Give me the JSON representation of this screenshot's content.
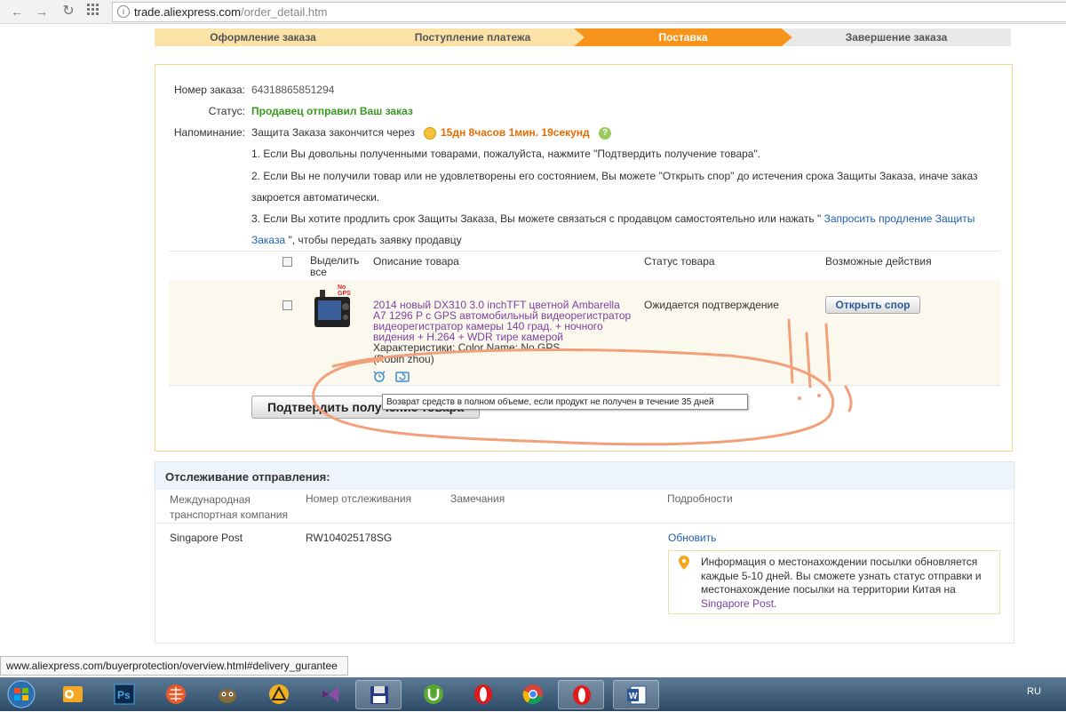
{
  "browser": {
    "url_domain": "trade.aliexpress.com",
    "url_path": "/order_detail.htm"
  },
  "steps": [
    {
      "label": "Оформление заказа",
      "state": "done"
    },
    {
      "label": "Поступление платежа",
      "state": "done"
    },
    {
      "label": "Поставка",
      "state": "current"
    },
    {
      "label": "Завершение заказа",
      "state": "pending"
    }
  ],
  "order": {
    "number_label": "Номер заказа:",
    "number": "64318865851294",
    "status_label": "Статус:",
    "status": "Продавец отправил Ваш заказ",
    "reminder_label": "Напоминание:",
    "reminder_text": "Защита Заказа закончится через",
    "countdown": "15дн 8часов 1мин. 19секунд",
    "note1": "1. Если Вы довольны полученными товарами, пожалуйста, нажмите \"Подтвердить получение товара\".",
    "note2_line1": "2. Если Вы не получили товар или не удовлетворены его состоянием, Вы можете \"Открыть спор\" до истечения срока Защиты Заказа, иначе заказ",
    "note2_line2": "закроется автоматически.",
    "note3_line1": "3. Если Вы хотите продлить срок Защиты Заказа, Вы можете связаться с продавцом самостоятельно или нажать \"",
    "note3_link_part1": "Запросить продление Защиты",
    "note3_link_part2": "Заказа",
    "note3_line2_rest": "\", чтобы передать заявку продавцу"
  },
  "table": {
    "select_all_line1": "Выделить",
    "select_all_line2": "все",
    "col_description": "Описание товара",
    "col_status": "Статус товара",
    "col_actions": "Возможные действия"
  },
  "product": {
    "badge": "No GPS",
    "title_lines": [
      "2014 новый DX310 3.0 inchTFT цветной Ambarella",
      "A7 1296 P с GPS автомобильный видеорегистратор",
      "видеорегистратор камеры 140 град. + ночного",
      "видения + H.264 + WDR тире камерой"
    ],
    "specs": "Характеристики: Color Name: No GPS",
    "seller": "(Robin zhou)",
    "status": "Ожидается подтверждение",
    "dispute_button": "Открыть спор"
  },
  "confirm_button": "Подтвердить получение товара",
  "tooltip": "Возврат средств в полном объеме, если продукт не получен в течение 35 дней",
  "tracking": {
    "title": "Отслеживание отправления:",
    "col_company_line1": "Международная",
    "col_company_line2": "транспортная компания",
    "col_number": "Номер отслеживания",
    "col_remarks": "Замечания",
    "col_details": "Подробности",
    "company": "Singapore Post",
    "tracking_number": "RW104025178SG",
    "refresh": "Обновить",
    "info_lines": [
      "Информация о местонахождении посылки обновляется",
      "каждые 5-10 дней. Вы сможете узнать статус отправки и",
      "местонахождение посылки на территории Китая на"
    ],
    "info_link": "Singapore Post."
  },
  "statusbar": "www.aliexpress.com/buyerprotection/overview.html#delivery_gurantee",
  "taskbar": {
    "language": "RU",
    "apps": [
      "windows-start",
      "outlook",
      "photoshop",
      "browser-grid",
      "gimp",
      "archicad",
      "visual-studio",
      "save-disk",
      "utorrent",
      "opera",
      "chrome",
      "opera-active",
      "word"
    ]
  },
  "colors": {
    "step_done": "#fbe3a8",
    "step_current": "#f6941c",
    "step_pending": "#e8e8e8",
    "status_green": "#3a9a1e",
    "countdown_orange": "#e86b00",
    "product_link": "#7f3fa0",
    "link_blue": "#2060b0",
    "annotation": "#f2a07a"
  }
}
